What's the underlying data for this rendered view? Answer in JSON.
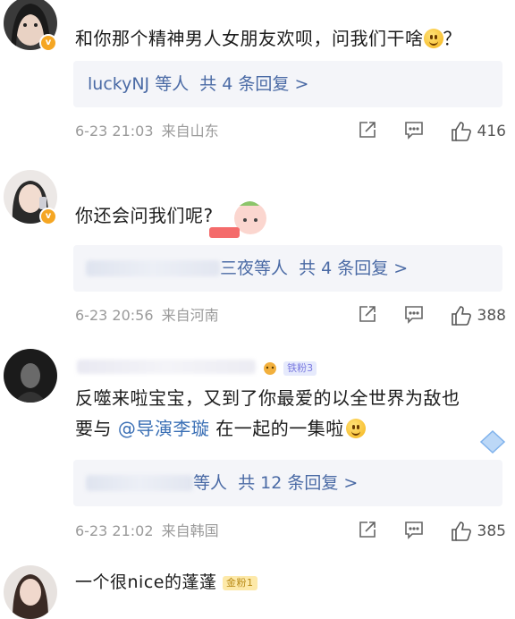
{
  "comments": [
    {
      "text": "和你那个精神男人女朋友欢呗，问我们干啥",
      "text_tail": "？",
      "reply_users": "luckyNJ 等人",
      "reply_count": "共 4 条回复 >",
      "time": "6-23 21:03",
      "location": "来自山东",
      "likes": "416"
    },
    {
      "text": "你还会问我们呢?",
      "reply_users_partial": "三夜等人",
      "reply_count": "共 4 条回复 >",
      "time": "6-23 20:56",
      "location": "来自河南",
      "likes": "388"
    },
    {
      "badge": "铁粉3",
      "text_line1": "反噬来啦宝宝，又到了你最爱的以全世界为敌也",
      "text_line2_pre": "要与 ",
      "mention": "@导演李璇",
      "text_line2_post": " 在一起的一集啦",
      "reply_users_partial": "等人",
      "reply_count": "共 12 条回复 >",
      "time": "6-23 21:02",
      "location": "来自韩国",
      "likes": "385"
    },
    {
      "text": "一个很nice的蓬蓬",
      "badge": "金粉1"
    }
  ],
  "colors": {
    "link": "#4a6aa5",
    "meta": "#9a9a9a",
    "mention": "#3a6fb5"
  },
  "icons": [
    "share-icon",
    "comment-icon",
    "like-icon",
    "verified-badge-icon",
    "smile-emoji-icon"
  ]
}
